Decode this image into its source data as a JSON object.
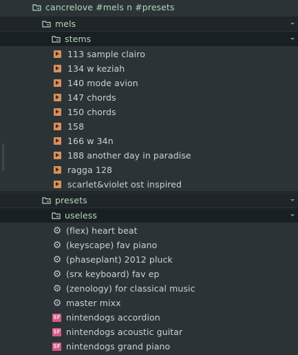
{
  "browser": {
    "root": {
      "label": "cancrelove #mels n #presets",
      "icon": "folder-open-icon"
    },
    "mels": {
      "label": "mels",
      "icon": "folder-open-icon",
      "stems": {
        "label": "stems",
        "icon": "folder-open-icon",
        "files": [
          "113 sample clairo",
          "134 w keziah",
          "140 mode avion",
          "147 chords",
          "150 chords",
          "158",
          "166 w 34n",
          "188 another day in paradise",
          "ragga 128",
          "scarlet&violet ost inspired"
        ]
      }
    },
    "presets": {
      "label": "presets",
      "icon": "folder-open-icon",
      "useless": {
        "label": "useless",
        "icon": "folder-open-icon",
        "plugin_presets": [
          "(flex) heart beat",
          "(keyscape) fav piano",
          "(phaseplant) 2012 pluck",
          "(srx keyboard) fav ep",
          "(zenology) for classical music",
          "master mixx"
        ],
        "soundfonts": [
          "nintendogs accordion",
          "nintendogs acoustic guitar",
          "nintendogs grand piano"
        ],
        "soundfont_badge": "SF"
      }
    }
  },
  "colors": {
    "background": "#2b3337",
    "folder_text": "#b6d7bd",
    "file_text": "#c9d2d6",
    "audio_icon": "#d9905a",
    "soundfont_icon": "#d45a82"
  }
}
